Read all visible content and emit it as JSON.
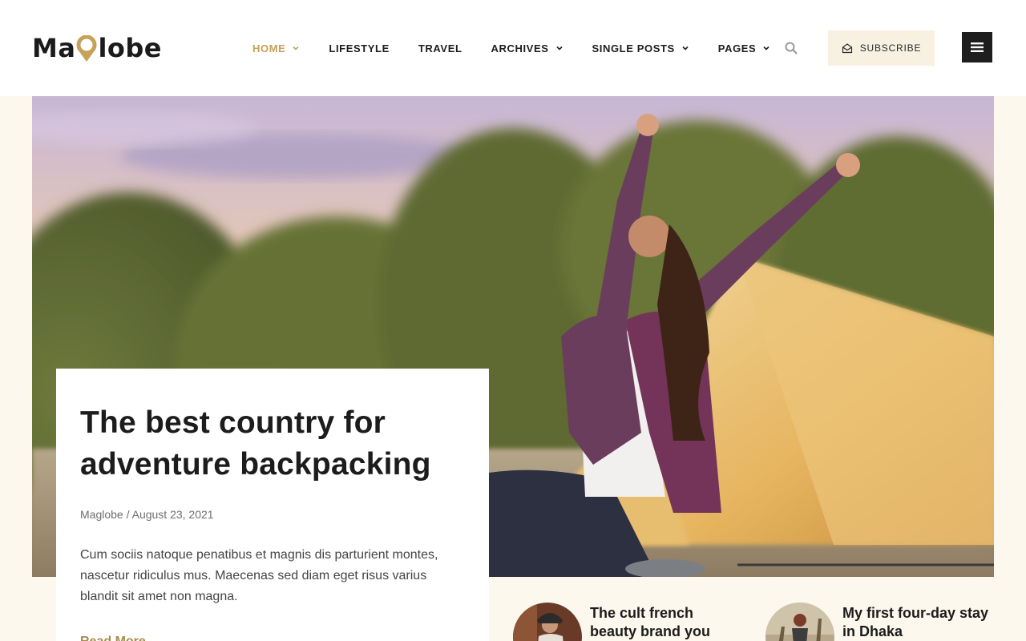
{
  "brand": {
    "logo_before": "Ma",
    "logo_after": "lobe",
    "accent": "#c5a15a"
  },
  "nav": {
    "items": [
      {
        "label": "HOME",
        "dropdown": true,
        "active": true
      },
      {
        "label": "LIFESTYLE",
        "dropdown": false
      },
      {
        "label": "TRAVEL",
        "dropdown": false
      },
      {
        "label": "ARCHIVES",
        "dropdown": true
      },
      {
        "label": "SINGLE POSTS",
        "dropdown": true
      },
      {
        "label": "PAGES",
        "dropdown": true
      }
    ],
    "search_icon": "search-icon",
    "subscribe_label": "SUBSCRIBE",
    "menu_icon": "hamburger-menu-icon"
  },
  "featured": {
    "title": "The best country for adventure backpacking",
    "meta": "Maglobe / August 23, 2021",
    "excerpt": "Cum sociis natoque penatibus et magnis dis parturient montes, nascetur ridiculus mus. Maecenas sed diam eget risus varius blandit sit amet non magna.",
    "read_more": "Read More"
  },
  "side_posts": [
    {
      "title": "The cult french beauty brand you"
    },
    {
      "title": "My first four-day stay in Dhaka"
    }
  ]
}
